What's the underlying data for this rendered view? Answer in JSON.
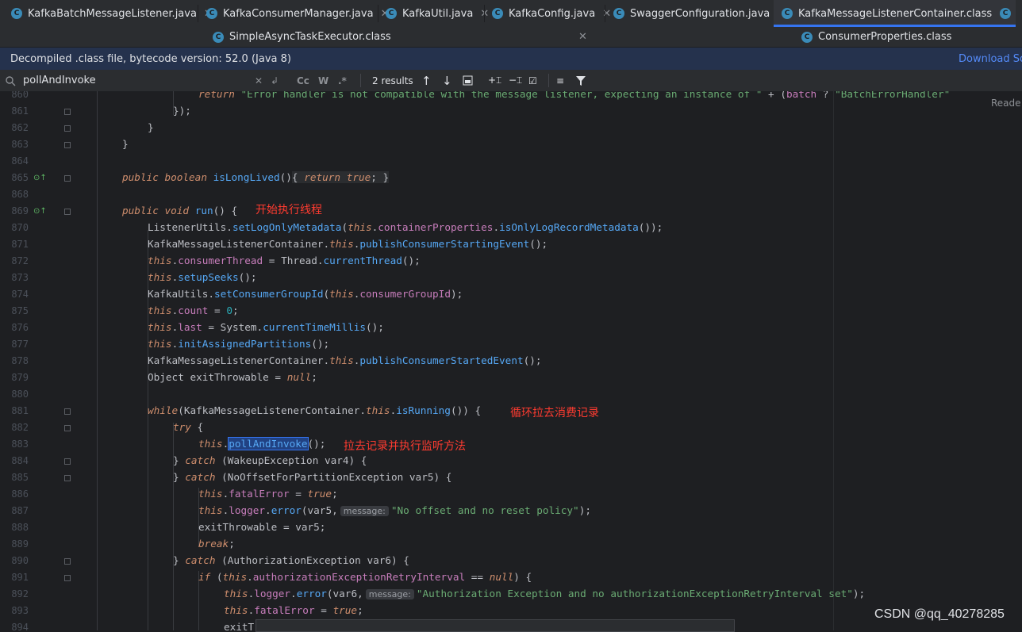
{
  "tabs_row1": [
    {
      "label": "KafkaBatchMessageListener.java",
      "icon": "class-icon"
    },
    {
      "label": "KafkaConsumerManager.java",
      "icon": "class-icon"
    },
    {
      "label": "KafkaUtil.java",
      "icon": "class-icon"
    },
    {
      "label": "KafkaConfig.java",
      "icon": "class-icon"
    },
    {
      "label": "SwaggerConfiguration.java",
      "icon": "class-icon"
    },
    {
      "label": "KafkaMessageListenerContainer.class",
      "icon": "class-icon",
      "active": true
    },
    {
      "label": "C",
      "icon": "class-icon"
    }
  ],
  "tabs_row2": [
    {
      "label": "SimpleAsyncTaskExecutor.class",
      "icon": "class-icon"
    },
    {
      "label": "ConsumerProperties.class",
      "icon": "class-icon"
    }
  ],
  "close_glyph": "✕",
  "banner": {
    "text": "Decompiled .class file, bytecode version: 52.0 (Java 8)",
    "link": "Download Sou"
  },
  "find": {
    "query": "pollAndInvoke",
    "results": "2 results",
    "cc": "Cc",
    "w": "W",
    "regex": ".*"
  },
  "reader_mode": "Reade",
  "line_numbers": [
    "860",
    "861",
    "862",
    "863",
    "864",
    "865",
    "868",
    "869",
    "870",
    "871",
    "872",
    "873",
    "874",
    "875",
    "876",
    "877",
    "878",
    "879",
    "880",
    "881",
    "882",
    "883",
    "884",
    "885",
    "886",
    "887",
    "888",
    "889",
    "890",
    "891",
    "892",
    "893",
    "894"
  ],
  "code": {
    "l860_return": "return",
    "l860_str": "\"Error handler is not compatible with the message listener, expecting an instance of \"",
    "l860_plus": " + (",
    "l860_batch": "batch",
    "l860_q": " ? ",
    "l860_str2": "\"BatchErrorHandler\"",
    "l861": "});",
    "l862": "}",
    "l863": "}",
    "l865_public": "public",
    "l865_boolean": "boolean",
    "l865_name": "isLongLived",
    "l865_paren": "()",
    "l865_body_open": "{ ",
    "l865_return": "return",
    "l865_true": "true",
    "l865_body_close": "; }",
    "l869_public": "public",
    "l869_void": "void",
    "l869_name": "run",
    "l869_rest": "() {",
    "l869_note": "开始执行线程",
    "l870_a": "ListenerUtils.",
    "l870_m": "setLogOnlyMetadata",
    "l870_b": "(",
    "l870_this": "this",
    "l870_dot": ".",
    "l870_f": "containerProperties",
    "l870_dot2": ".",
    "l870_m2": "isOnlyLogRecordMetadata",
    "l870_c": "());",
    "l871_a": "KafkaMessageListenerContainer.",
    "l871_this": "this",
    "l871_dot": ".",
    "l871_m": "publishConsumerStartingEvent",
    "l871_c": "();",
    "l872_this": "this",
    "l872_dot": ".",
    "l872_f": "consumerThread",
    "l872_b": " = Thread.",
    "l872_m": "currentThread",
    "l872_c": "();",
    "l873_this": "this",
    "l873_dot": ".",
    "l873_m": "setupSeeks",
    "l873_c": "();",
    "l874_a": "KafkaUtils.",
    "l874_m": "setConsumerGroupId",
    "l874_b": "(",
    "l874_this": "this",
    "l874_dot": ".",
    "l874_f": "consumerGroupId",
    "l874_c": ");",
    "l875_this": "this",
    "l875_dot": ".",
    "l875_f": "count",
    "l875_b": " = ",
    "l875_n": "0",
    "l875_c": ";",
    "l876_this": "this",
    "l876_dot": ".",
    "l876_f": "last",
    "l876_b": " = System.",
    "l876_m": "currentTimeMillis",
    "l876_c": "();",
    "l877_this": "this",
    "l877_dot": ".",
    "l877_m": "initAssignedPartitions",
    "l877_c": "();",
    "l878_a": "KafkaMessageListenerContainer.",
    "l878_this": "this",
    "l878_dot": ".",
    "l878_m": "publishConsumerStartedEvent",
    "l878_c": "();",
    "l879_a": "Object exitThrowable = ",
    "l879_null": "null",
    "l879_c": ";",
    "l881_while": "while",
    "l881_a": "(KafkaMessageListenerContainer.",
    "l881_this": "this",
    "l881_dot": ".",
    "l881_m": "isRunning",
    "l881_c": "()) {",
    "l881_note": "循环拉去消费记录",
    "l882_try": "try",
    "l882_c": " {",
    "l883_this": "this",
    "l883_dot": ".",
    "l883_m": "pollAndInvoke",
    "l883_c": "();",
    "l883_note": "拉去记录并执行监听方法",
    "l884_a": "} ",
    "l884_catch": "catch",
    "l884_b": " (WakeupException var4) {",
    "l885_a": "} ",
    "l885_catch": "catch",
    "l885_b": " (NoOffsetForPartitionException var5) {",
    "l886_this": "this",
    "l886_dot": ".",
    "l886_f": "fatalError",
    "l886_b": " = ",
    "l886_true": "true",
    "l886_c": ";",
    "l887_this": "this",
    "l887_dot": ".",
    "l887_f": "logger",
    "l887_dot2": ".",
    "l887_m": "error",
    "l887_b": "(var5,",
    "l887_hint": "message:",
    "l887_str": "\"No offset and no reset policy\"",
    "l887_c": ");",
    "l888": "exitThrowable = var5;",
    "l889_break": "break",
    "l889_c": ";",
    "l890_a": "} ",
    "l890_catch": "catch",
    "l890_b": " (AuthorizationException var6) {",
    "l891_if": "if",
    "l891_a": " (",
    "l891_this": "this",
    "l891_dot": ".",
    "l891_f": "authorizationExceptionRetryInterval",
    "l891_b": " == ",
    "l891_null": "null",
    "l891_c": ") {",
    "l892_this": "this",
    "l892_dot": ".",
    "l892_f": "logger",
    "l892_dot2": ".",
    "l892_m": "error",
    "l892_b": "(var6,",
    "l892_hint": "message:",
    "l892_str": "\"Authorization Exception and no authorizationExceptionRetryInterval set\"",
    "l892_c": ");",
    "l893_this": "this",
    "l893_dot": ".",
    "l893_f": "fatalError",
    "l893_b": " = ",
    "l893_true": "true",
    "l893_c": ";",
    "l894": "exitT"
  },
  "watermark": "CSDN @qq_40278285",
  "colors": {
    "keyword": "#cf8e6d",
    "field": "#c77dbb",
    "method": "#56a8f5",
    "number": "#2aacb8",
    "string": "#6aab73",
    "annotation": "#ff3b30",
    "accent": "#3574f0"
  }
}
